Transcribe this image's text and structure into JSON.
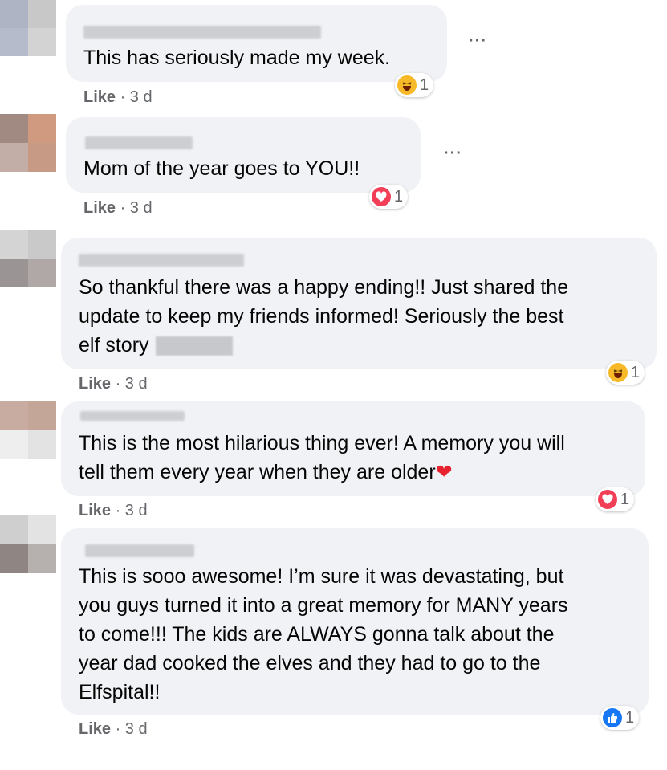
{
  "comments": [
    {
      "text": "This has seriously made my week.",
      "like_label": "Like",
      "time": " · 3 d",
      "reaction_icon": "haha-icon",
      "reaction_count": "1",
      "more_label": "···"
    },
    {
      "text": "Mom of the year goes to YOU!!",
      "like_label": "Like",
      "time": " · 3 d",
      "reaction_icon": "love-icon",
      "reaction_count": "1",
      "more_label": "···"
    },
    {
      "text": "So thankful there was a happy ending!! Just shared the\nupdate to keep my friends informed! Seriously the best\nelf story",
      "like_label": "Like",
      "time": " · 3 d",
      "reaction_icon": "haha-icon",
      "reaction_count": "1"
    },
    {
      "text": "This is the most hilarious thing ever! A memory you will\ntell them every year when they are older",
      "heart": "❤",
      "like_label": "Like",
      "time": " · 3 d",
      "reaction_icon": "love-icon",
      "reaction_count": "1"
    },
    {
      "text": "This is sooo awesome! I’m sure it was devastating, but\nyou guys turned it into a great memory for MANY years\nto come!!! The kids are ALWAYS gonna talk about the\nyear dad cooked the elves and they had to go to the\nElfspital!!",
      "like_label": "Like",
      "time": " · 3 d",
      "reaction_icon": "like-icon",
      "reaction_count": "1"
    }
  ],
  "colors": {
    "haha": "#f7b928",
    "love": "#f33e58",
    "like": "#1877f2",
    "bubble": "#f0f2f5"
  }
}
